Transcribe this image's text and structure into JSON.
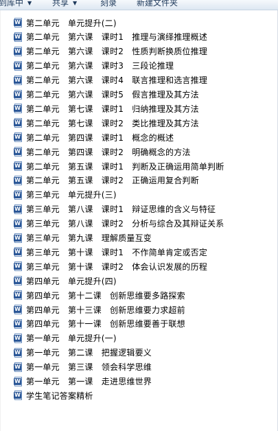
{
  "toolbar": {
    "items": [
      {
        "label": "到库中",
        "has_dropdown": true
      },
      {
        "label": "共享",
        "has_dropdown": true
      },
      {
        "label": "刻录",
        "has_dropdown": false
      },
      {
        "label": "新建文件夹",
        "has_dropdown": false
      }
    ],
    "dropdown_glyph": "▼"
  },
  "file_icon": {
    "glyph": "W",
    "color": "#2b5797"
  },
  "files": [
    "第二单元　单元提升(二)",
    "第二单元　第六课　课时1　推理与演绎推理概述",
    "第二单元　第六课　课时2　性质判断换质位推理",
    "第二单元　第六课　课时3　三段论推理",
    "第二单元　第六课　课时4　联言推理和选言推理",
    "第二单元　第六课　课时5　假言推理及其方法",
    "第二单元　第七课　课时1　归纳推理及其方法",
    "第二单元　第七课　课时2　类比推理及其方法",
    "第二单元　第四课　课时1　概念的概述",
    "第二单元　第四课　课时2　明确概念的方法",
    "第二单元　第五课　课时1　判断及正确运用简单判断",
    "第二单元　第五课　课时2　正确运用复合判断",
    "第三单元　单元提升(三)",
    "第三单元　第八课　课时1　辩证思维的含义与特征",
    "第三单元　第八课　课时2　分析与综合及其辩证关系",
    "第三单元　第九课　理解质量互变",
    "第三单元　第十课　课时1　不作简单肯定或否定",
    "第三单元　第十课　课时2　体会认识发展的历程",
    "第四单元　单元提升(四)",
    "第四单元　第十二课　创新思维要多路探索",
    "第四单元　第十三课　创新思维要力求超前",
    "第四单元　第十一课　创新思维要善于联想",
    "第一单元　单元提升(一)",
    "第一单元　第二课　把握逻辑要义",
    "第一单元　第三课　领会科学思维",
    "第一单元　第一课　走进思维世界",
    "学生笔记答案精析"
  ]
}
